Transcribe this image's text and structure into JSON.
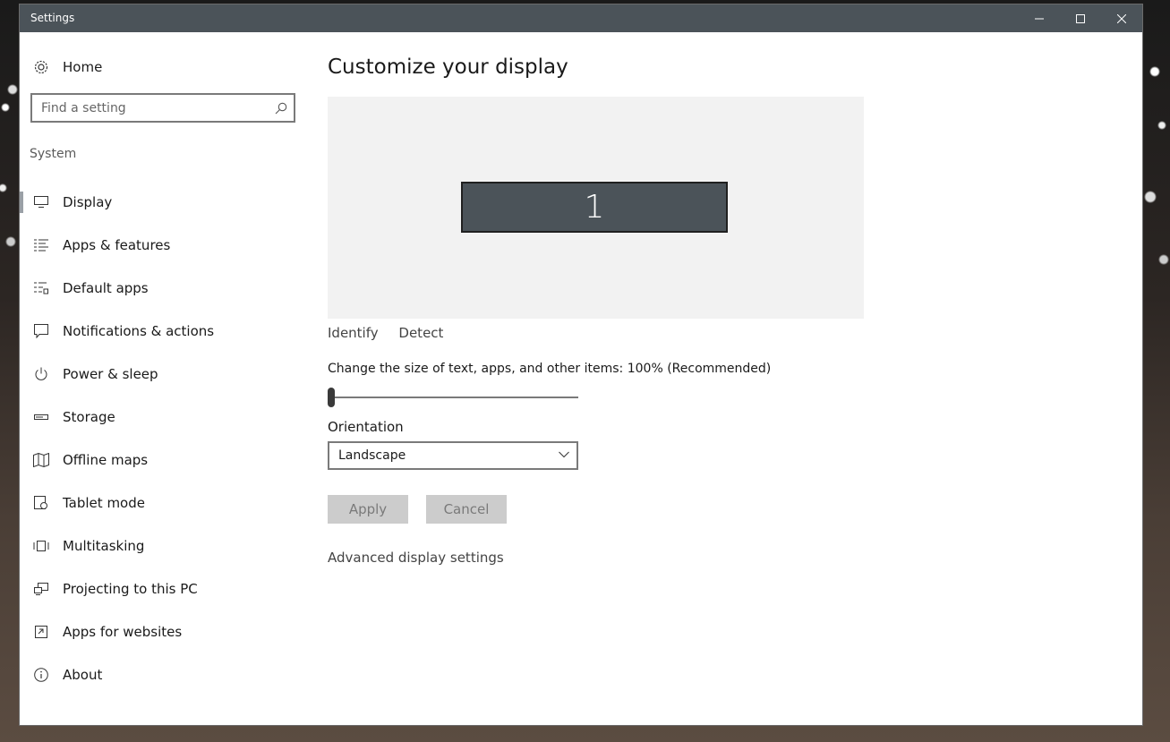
{
  "window": {
    "title": "Settings"
  },
  "sidebar": {
    "home_label": "Home",
    "search_placeholder": "Find a setting",
    "section_label": "System",
    "items": [
      {
        "label": "Display",
        "icon": "monitor-icon"
      },
      {
        "label": "Apps & features",
        "icon": "list-icon"
      },
      {
        "label": "Default apps",
        "icon": "default-apps-icon"
      },
      {
        "label": "Notifications & actions",
        "icon": "notification-icon"
      },
      {
        "label": "Power & sleep",
        "icon": "power-icon"
      },
      {
        "label": "Storage",
        "icon": "storage-icon"
      },
      {
        "label": "Offline maps",
        "icon": "map-icon"
      },
      {
        "label": "Tablet mode",
        "icon": "tablet-mode-icon"
      },
      {
        "label": "Multitasking",
        "icon": "multitasking-icon"
      },
      {
        "label": "Projecting to this PC",
        "icon": "projecting-icon"
      },
      {
        "label": "Apps for websites",
        "icon": "apps-websites-icon"
      },
      {
        "label": "About",
        "icon": "info-icon"
      }
    ],
    "selected": "Display"
  },
  "main": {
    "title": "Customize your display",
    "monitor_number": "1",
    "identify_label": "Identify",
    "detect_label": "Detect",
    "scale_label": "Change the size of text, apps, and other items: 100% (Recommended)",
    "scale_slider_value": 0,
    "orientation_label": "Orientation",
    "orientation_value": "Landscape",
    "apply_label": "Apply",
    "cancel_label": "Cancel",
    "advanced_link": "Advanced display settings"
  },
  "colors": {
    "titlebar": "#4b5359",
    "monitor_fill": "#4b5359",
    "preview_bg": "#f2f2f2",
    "button_disabled_bg": "#cccccc"
  }
}
